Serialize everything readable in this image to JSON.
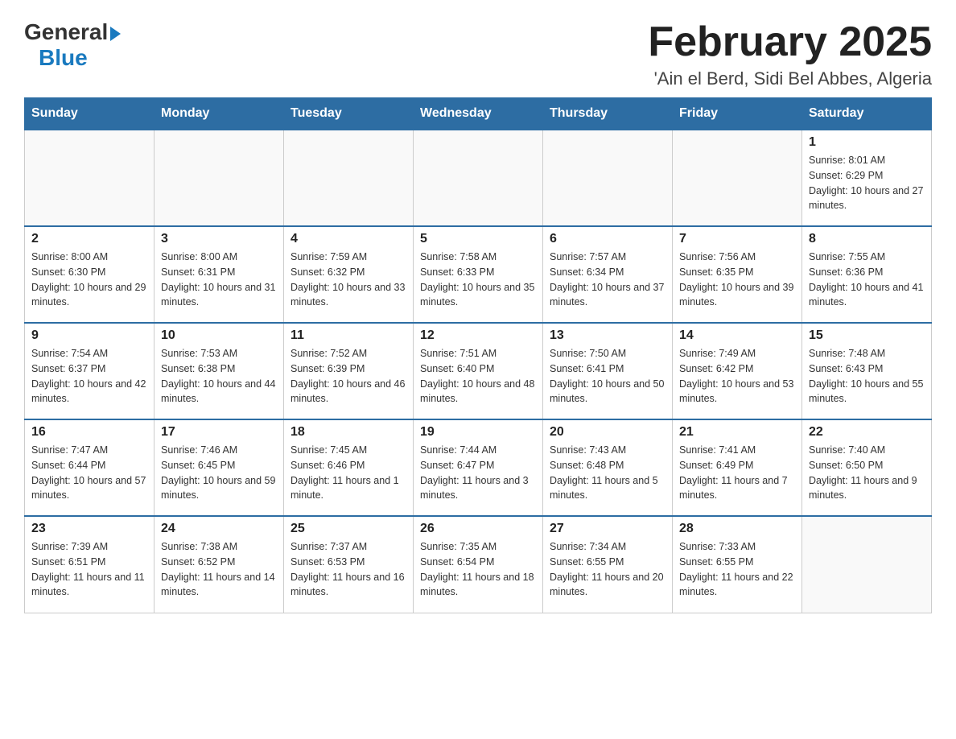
{
  "header": {
    "logo_general": "General",
    "logo_blue": "Blue",
    "main_title": "February 2025",
    "subtitle": "'Ain el Berd, Sidi Bel Abbes, Algeria"
  },
  "calendar": {
    "days_of_week": [
      "Sunday",
      "Monday",
      "Tuesday",
      "Wednesday",
      "Thursday",
      "Friday",
      "Saturday"
    ],
    "weeks": [
      [
        {
          "day": "",
          "info": ""
        },
        {
          "day": "",
          "info": ""
        },
        {
          "day": "",
          "info": ""
        },
        {
          "day": "",
          "info": ""
        },
        {
          "day": "",
          "info": ""
        },
        {
          "day": "",
          "info": ""
        },
        {
          "day": "1",
          "info": "Sunrise: 8:01 AM\nSunset: 6:29 PM\nDaylight: 10 hours and 27 minutes."
        }
      ],
      [
        {
          "day": "2",
          "info": "Sunrise: 8:00 AM\nSunset: 6:30 PM\nDaylight: 10 hours and 29 minutes."
        },
        {
          "day": "3",
          "info": "Sunrise: 8:00 AM\nSunset: 6:31 PM\nDaylight: 10 hours and 31 minutes."
        },
        {
          "day": "4",
          "info": "Sunrise: 7:59 AM\nSunset: 6:32 PM\nDaylight: 10 hours and 33 minutes."
        },
        {
          "day": "5",
          "info": "Sunrise: 7:58 AM\nSunset: 6:33 PM\nDaylight: 10 hours and 35 minutes."
        },
        {
          "day": "6",
          "info": "Sunrise: 7:57 AM\nSunset: 6:34 PM\nDaylight: 10 hours and 37 minutes."
        },
        {
          "day": "7",
          "info": "Sunrise: 7:56 AM\nSunset: 6:35 PM\nDaylight: 10 hours and 39 minutes."
        },
        {
          "day": "8",
          "info": "Sunrise: 7:55 AM\nSunset: 6:36 PM\nDaylight: 10 hours and 41 minutes."
        }
      ],
      [
        {
          "day": "9",
          "info": "Sunrise: 7:54 AM\nSunset: 6:37 PM\nDaylight: 10 hours and 42 minutes."
        },
        {
          "day": "10",
          "info": "Sunrise: 7:53 AM\nSunset: 6:38 PM\nDaylight: 10 hours and 44 minutes."
        },
        {
          "day": "11",
          "info": "Sunrise: 7:52 AM\nSunset: 6:39 PM\nDaylight: 10 hours and 46 minutes."
        },
        {
          "day": "12",
          "info": "Sunrise: 7:51 AM\nSunset: 6:40 PM\nDaylight: 10 hours and 48 minutes."
        },
        {
          "day": "13",
          "info": "Sunrise: 7:50 AM\nSunset: 6:41 PM\nDaylight: 10 hours and 50 minutes."
        },
        {
          "day": "14",
          "info": "Sunrise: 7:49 AM\nSunset: 6:42 PM\nDaylight: 10 hours and 53 minutes."
        },
        {
          "day": "15",
          "info": "Sunrise: 7:48 AM\nSunset: 6:43 PM\nDaylight: 10 hours and 55 minutes."
        }
      ],
      [
        {
          "day": "16",
          "info": "Sunrise: 7:47 AM\nSunset: 6:44 PM\nDaylight: 10 hours and 57 minutes."
        },
        {
          "day": "17",
          "info": "Sunrise: 7:46 AM\nSunset: 6:45 PM\nDaylight: 10 hours and 59 minutes."
        },
        {
          "day": "18",
          "info": "Sunrise: 7:45 AM\nSunset: 6:46 PM\nDaylight: 11 hours and 1 minute."
        },
        {
          "day": "19",
          "info": "Sunrise: 7:44 AM\nSunset: 6:47 PM\nDaylight: 11 hours and 3 minutes."
        },
        {
          "day": "20",
          "info": "Sunrise: 7:43 AM\nSunset: 6:48 PM\nDaylight: 11 hours and 5 minutes."
        },
        {
          "day": "21",
          "info": "Sunrise: 7:41 AM\nSunset: 6:49 PM\nDaylight: 11 hours and 7 minutes."
        },
        {
          "day": "22",
          "info": "Sunrise: 7:40 AM\nSunset: 6:50 PM\nDaylight: 11 hours and 9 minutes."
        }
      ],
      [
        {
          "day": "23",
          "info": "Sunrise: 7:39 AM\nSunset: 6:51 PM\nDaylight: 11 hours and 11 minutes."
        },
        {
          "day": "24",
          "info": "Sunrise: 7:38 AM\nSunset: 6:52 PM\nDaylight: 11 hours and 14 minutes."
        },
        {
          "day": "25",
          "info": "Sunrise: 7:37 AM\nSunset: 6:53 PM\nDaylight: 11 hours and 16 minutes."
        },
        {
          "day": "26",
          "info": "Sunrise: 7:35 AM\nSunset: 6:54 PM\nDaylight: 11 hours and 18 minutes."
        },
        {
          "day": "27",
          "info": "Sunrise: 7:34 AM\nSunset: 6:55 PM\nDaylight: 11 hours and 20 minutes."
        },
        {
          "day": "28",
          "info": "Sunrise: 7:33 AM\nSunset: 6:55 PM\nDaylight: 11 hours and 22 minutes."
        },
        {
          "day": "",
          "info": ""
        }
      ]
    ]
  }
}
